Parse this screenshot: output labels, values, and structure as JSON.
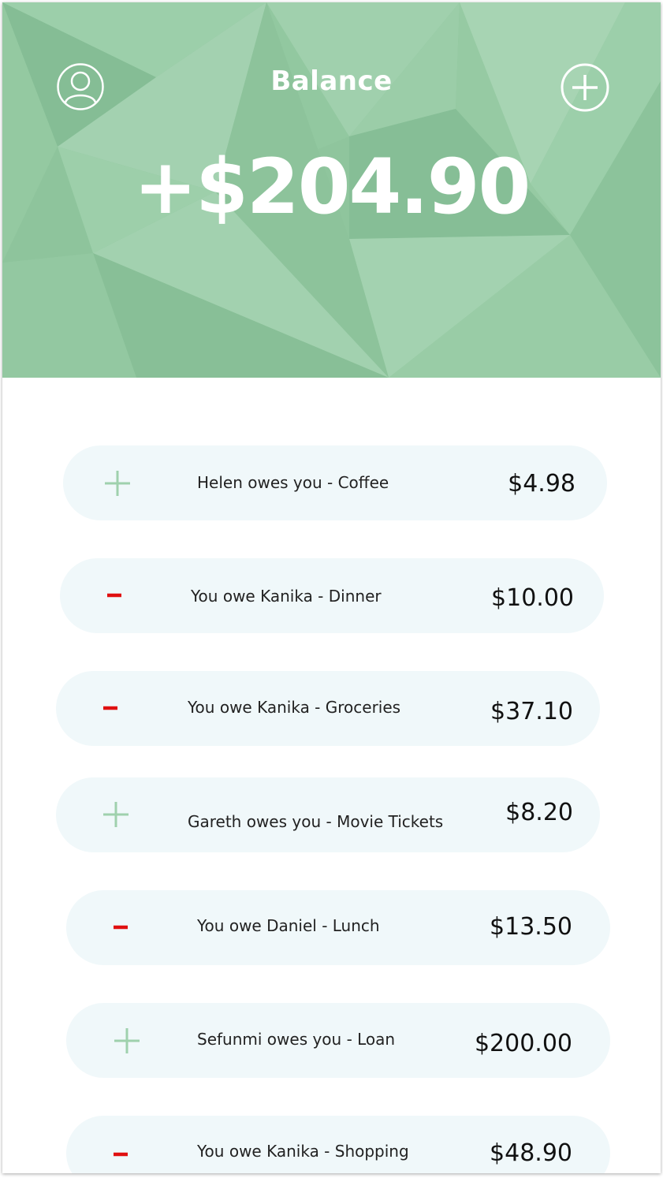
{
  "header": {
    "title": "Balance",
    "balance": "+$204.90",
    "background_color": "#8fc59d",
    "profile_icon": "user-circle-icon",
    "add_icon": "plus-circle-icon"
  },
  "transactions": [
    {
      "type": "owed",
      "sign_icon": "plus-icon",
      "description": "Helen owes you - Coffee",
      "amount": "$4.98"
    },
    {
      "type": "owe",
      "sign_icon": "minus-icon",
      "description": "You owe Kanika - Dinner",
      "amount": "$10.00"
    },
    {
      "type": "owe",
      "sign_icon": "minus-icon",
      "description": "You owe Kanika - Groceries",
      "amount": "$37.10"
    },
    {
      "type": "owed",
      "sign_icon": "plus-icon",
      "description": "Gareth owes you - Movie Tickets",
      "amount": "$8.20"
    },
    {
      "type": "owe",
      "sign_icon": "minus-icon",
      "description": "You owe Daniel - Lunch",
      "amount": "$13.50"
    },
    {
      "type": "owed",
      "sign_icon": "plus-icon",
      "description": "Sefunmi owes you - Loan",
      "amount": "$200.00"
    },
    {
      "type": "owe",
      "sign_icon": "minus-icon",
      "description": "You owe Kanika - Shopping",
      "amount": "$48.90"
    }
  ],
  "colors": {
    "positive": "#9fd1ad",
    "negative": "#e01010",
    "row_background": "#f0f8fa"
  }
}
